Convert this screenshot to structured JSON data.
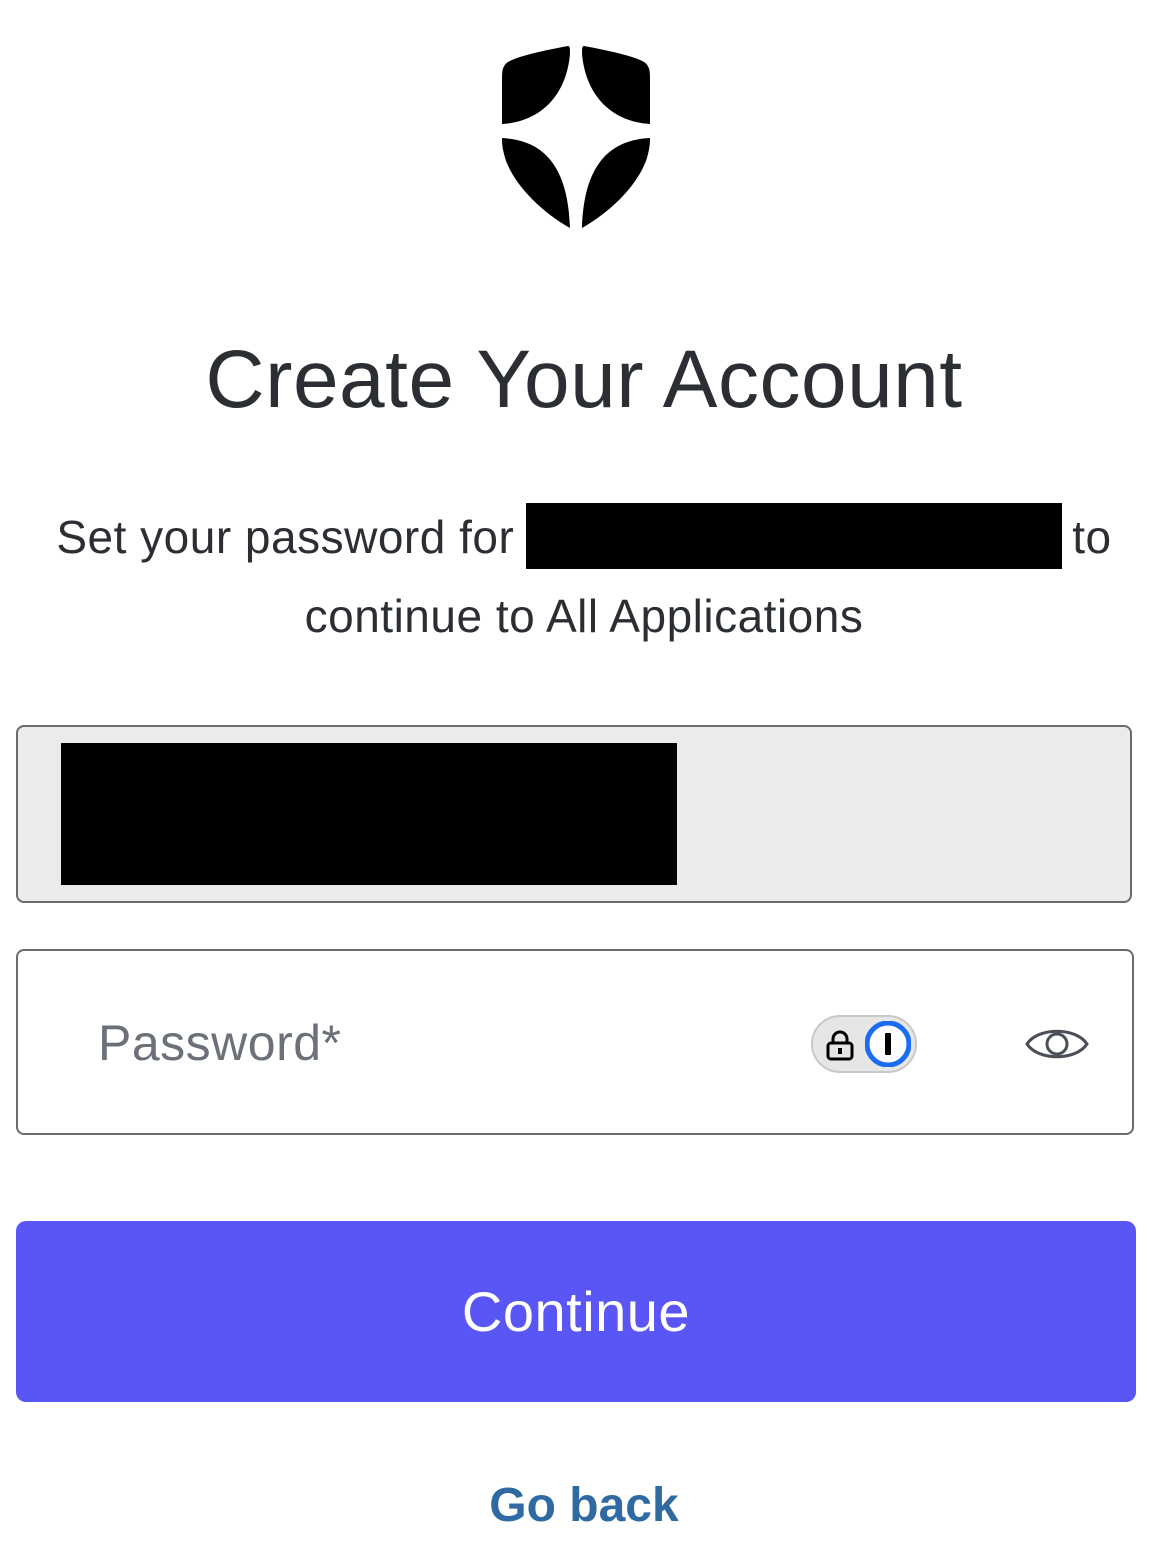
{
  "logo": {
    "icon": "shield-star-logo",
    "color": "#000000"
  },
  "header": {
    "title": "Create Your Account"
  },
  "description": {
    "prefix": "Set your password for",
    "redacted_email": "",
    "suffix": "to",
    "line2": "continue to All Applications"
  },
  "form": {
    "email_field": {
      "value": "",
      "redacted": true
    },
    "password_field": {
      "placeholder": "Password*",
      "value": "",
      "password_manager_icon": "1password-icon",
      "reveal_icon": "eye-icon"
    }
  },
  "actions": {
    "continue_label": "Continue",
    "go_back_label": "Go back"
  },
  "colors": {
    "primary": "#5a56f6",
    "link": "#2f6aa3",
    "text": "#2b2e33",
    "placeholder": "#6b7079",
    "disabled_field_bg": "#ebebeb"
  }
}
